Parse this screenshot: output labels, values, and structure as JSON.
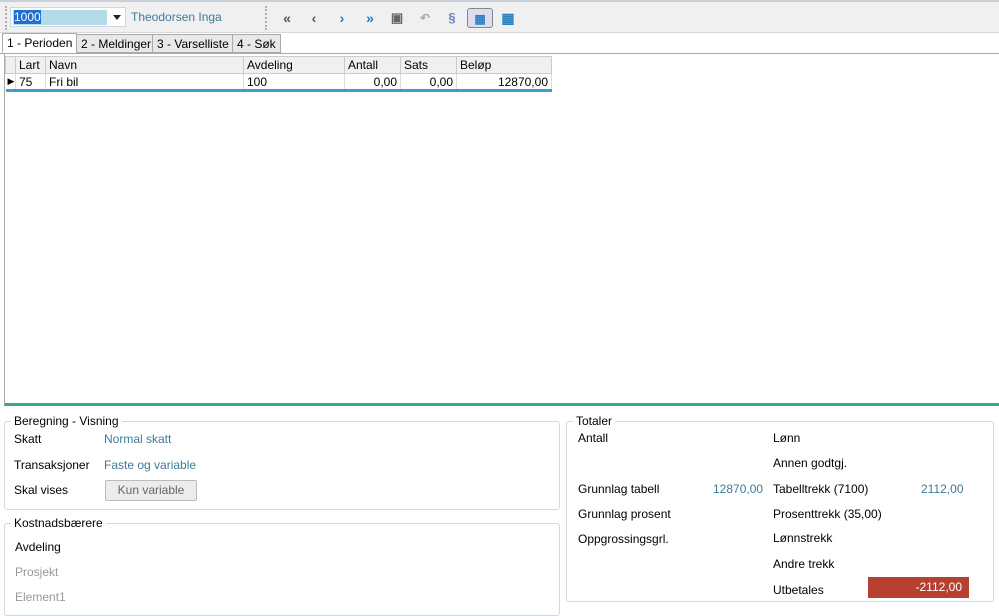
{
  "toolbar": {
    "employee_id": "1000",
    "employee_name": "Theodorsen Inga"
  },
  "tabs": [
    {
      "label": "1 - Perioden"
    },
    {
      "label": "2 - Meldinger"
    },
    {
      "label": "3 - Varselliste"
    },
    {
      "label": "4 - Søk"
    }
  ],
  "table": {
    "columns": [
      "Lart",
      "Navn",
      "Avdeling",
      "Antall",
      "Sats",
      "Beløp"
    ],
    "rows": [
      {
        "lart": "75",
        "navn": "Fri bil",
        "avdeling": "100",
        "antall": "0,00",
        "sats": "0,00",
        "belop": "12870,00"
      }
    ]
  },
  "beregning": {
    "title": "Beregning - Visning",
    "skatt_label": "Skatt",
    "skatt_value": "Normal skatt",
    "trans_label": "Transaksjoner",
    "trans_value": "Faste og variable",
    "vises_label": "Skal vises",
    "vises_button": "Kun variable"
  },
  "kostnad": {
    "title": "Kostnadsbærere",
    "avdeling": "Avdeling",
    "prosjekt": "Prosjekt",
    "element1": "Element1"
  },
  "totaler": {
    "title": "Totaler",
    "antall": "Antall",
    "grunnlag_tabell": "Grunnlag tabell",
    "grunnlag_tabell_value": "12870,00",
    "grunnlag_prosent": "Grunnlag prosent",
    "oppgrossing": "Oppgrossingsgrl.",
    "lonn": "Lønn",
    "annen": "Annen godtgj.",
    "tabelltrekk": "Tabelltrekk (7100)",
    "tabelltrekk_value": "2112,00",
    "prosenttrekk": "Prosenttrekk (35,00)",
    "lonnstrekk": "Lønnstrekk",
    "andre": "Andre trekk",
    "utbetales": "Utbetales",
    "utbetales_value": "-2112,00"
  }
}
